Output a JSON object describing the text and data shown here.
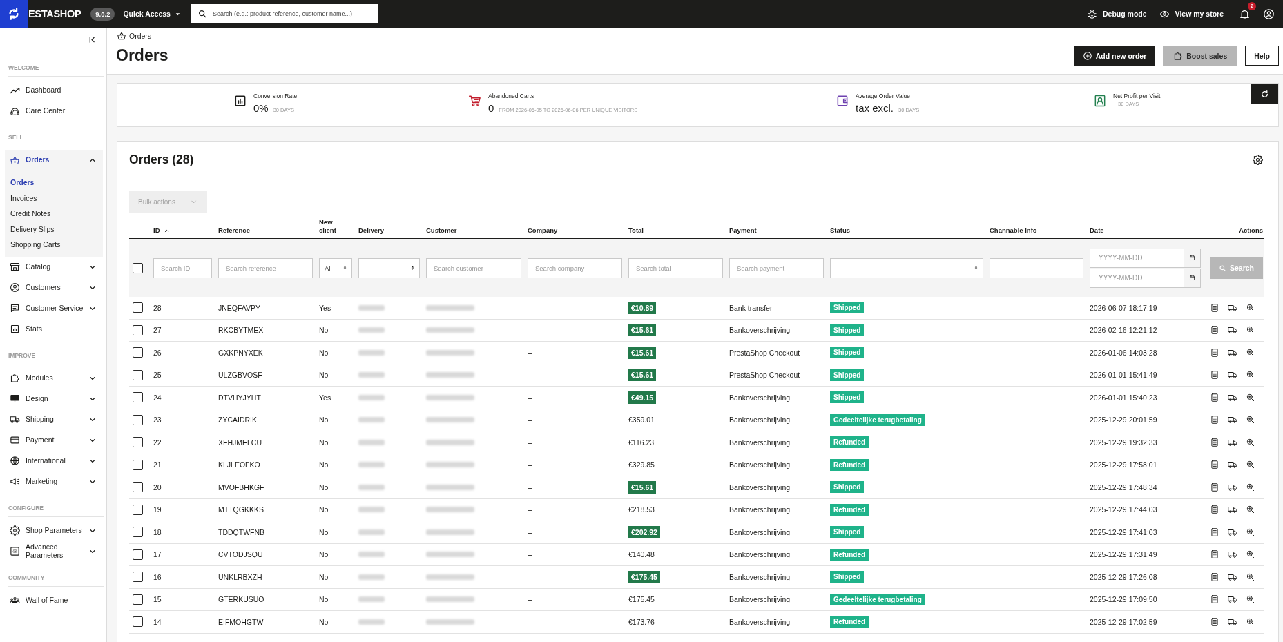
{
  "topbar": {
    "logo_text": "ESTASHOP",
    "version": "9.0.2",
    "quick_access": "Quick Access",
    "search": {
      "placeholder": "Search (e.g.: product reference, customer name...)"
    },
    "debug_mode": "Debug mode",
    "view_store": "View my store",
    "notification_count": "2"
  },
  "sidebar": {
    "sections": [
      {
        "title": "WELCOME",
        "items": [
          {
            "label": "Dashboard",
            "kind": "link",
            "selected": false
          },
          {
            "label": "Care Center",
            "kind": "link",
            "selected": false
          }
        ]
      },
      {
        "title": "SELL",
        "items": [
          {
            "label": "Orders",
            "kind": "menu",
            "selected": true,
            "expanded": true,
            "children": [
              {
                "label": "Orders",
                "selected": true
              },
              {
                "label": "Invoices",
                "selected": false
              },
              {
                "label": "Credit Notes",
                "selected": false
              },
              {
                "label": "Delivery Slips",
                "selected": false
              },
              {
                "label": "Shopping Carts",
                "selected": false
              }
            ]
          },
          {
            "label": "Catalog",
            "kind": "menu",
            "selected": false,
            "expanded": false
          },
          {
            "label": "Customers",
            "kind": "menu",
            "selected": false,
            "expanded": false
          },
          {
            "label": "Customer Service",
            "kind": "menu",
            "selected": false,
            "expanded": false
          },
          {
            "label": "Stats",
            "kind": "link",
            "selected": false
          }
        ]
      },
      {
        "title": "IMPROVE",
        "items": [
          {
            "label": "Modules",
            "kind": "menu",
            "selected": false,
            "expanded": false
          },
          {
            "label": "Design",
            "kind": "menu",
            "selected": false,
            "expanded": false
          },
          {
            "label": "Shipping",
            "kind": "menu",
            "selected": false,
            "expanded": false
          },
          {
            "label": "Payment",
            "kind": "menu",
            "selected": false,
            "expanded": false
          },
          {
            "label": "International",
            "kind": "menu",
            "selected": false,
            "expanded": false
          },
          {
            "label": "Marketing",
            "kind": "menu",
            "selected": false,
            "expanded": false
          }
        ]
      },
      {
        "title": "CONFIGURE",
        "items": [
          {
            "label": "Shop Parameters",
            "kind": "menu",
            "selected": false,
            "expanded": false
          },
          {
            "label": "Advanced Parameters",
            "kind": "menu",
            "selected": false,
            "expanded": false
          }
        ]
      },
      {
        "title": "COMMUNITY",
        "items": [
          {
            "label": "Wall of Fame",
            "kind": "link",
            "selected": false
          }
        ]
      }
    ]
  },
  "header": {
    "breadcrumb": "Orders",
    "title": "Orders",
    "buttons": [
      {
        "label": "Add new order",
        "kind": "primary"
      },
      {
        "label": "Boost sales",
        "kind": "secondary"
      },
      {
        "label": "Help",
        "kind": "outline"
      }
    ]
  },
  "kpis": [
    {
      "title": "Conversion Rate",
      "value": "0%",
      "period": "30 DAYS",
      "color": "#1d1d1b"
    },
    {
      "title": "Abandoned Carts",
      "value": "0",
      "period": "FROM 2026-06-05 TO 2026-06-06 PER UNIQUE VISITORS",
      "color": "#c3202f"
    },
    {
      "title": "Average Order Value",
      "value": "tax excl.",
      "period": "30 DAYS",
      "color": "#6f42b0"
    },
    {
      "title": "Net Profit per Visit",
      "period": "30 DAYS",
      "color": "#23804f"
    }
  ],
  "orders": {
    "title": "Orders (28)",
    "bulk_actions": {
      "label": "Bulk actions",
      "disabled": true
    },
    "select_all": {
      "checked": false
    },
    "columns": [
      {
        "label": "ID",
        "sorted_ascending": true
      },
      {
        "label": "Reference"
      },
      {
        "label": "New client"
      },
      {
        "label": "Delivery"
      },
      {
        "label": "Customer"
      },
      {
        "label": "Company"
      },
      {
        "label": "Total"
      },
      {
        "label": "Payment"
      },
      {
        "label": "Status"
      },
      {
        "label": "Channable Info"
      },
      {
        "label": "Date"
      },
      {
        "label": "Actions"
      }
    ],
    "filters": [
      {
        "kind": "input",
        "placeholder": "Search ID"
      },
      {
        "kind": "input",
        "placeholder": "Search reference"
      },
      {
        "kind": "select",
        "value": "All"
      },
      {
        "kind": "select"
      },
      {
        "kind": "input",
        "placeholder": "Search customer"
      },
      {
        "kind": "input",
        "placeholder": "Search company"
      },
      {
        "kind": "input",
        "placeholder": "Search total"
      },
      {
        "kind": "input",
        "placeholder": "Search payment"
      },
      {
        "kind": "select"
      },
      {
        "kind": "input"
      },
      {
        "kind": "date",
        "from_placeholder": "YYYY-MM-DD",
        "to_placeholder": "YYYY-MM-DD"
      },
      {
        "kind": "button",
        "label": "Search",
        "disabled": true
      }
    ],
    "rows": [
      {
        "checked": false,
        "id": "28",
        "reference": "JNEQFAVPY",
        "new_client": "Yes",
        "company": "--",
        "total": "€10.89",
        "total_highlighted": true,
        "payment": "Bank transfer",
        "status": "Shipped",
        "date": "2026-06-07 18:17:19"
      },
      {
        "checked": false,
        "id": "27",
        "reference": "RKCBYTMEX",
        "new_client": "No",
        "company": "--",
        "total": "€15.61",
        "total_highlighted": true,
        "payment": "Bankoverschrijving",
        "status": "Shipped",
        "date": "2026-02-16 12:21:12"
      },
      {
        "checked": false,
        "id": "26",
        "reference": "GXKPNYXEK",
        "new_client": "No",
        "company": "--",
        "total": "€15.61",
        "total_highlighted": true,
        "payment": "PrestaShop Checkout",
        "status": "Shipped",
        "date": "2026-01-06 14:03:28"
      },
      {
        "checked": false,
        "id": "25",
        "reference": "ULZGBVOSF",
        "new_client": "No",
        "company": "--",
        "total": "€15.61",
        "total_highlighted": true,
        "payment": "PrestaShop Checkout",
        "status": "Shipped",
        "date": "2026-01-01 15:41:49"
      },
      {
        "checked": false,
        "id": "24",
        "reference": "DTVHYJYHT",
        "new_client": "Yes",
        "company": "--",
        "total": "€49.15",
        "total_highlighted": true,
        "payment": "Bankoverschrijving",
        "status": "Shipped",
        "date": "2026-01-01 15:40:23"
      },
      {
        "checked": false,
        "id": "23",
        "reference": "ZYCAIDRIK",
        "new_client": "No",
        "company": "--",
        "total": "€359.01",
        "total_highlighted": false,
        "payment": "Bankoverschrijving",
        "status": "Gedeeltelijke terugbetaling",
        "date": "2025-12-29 20:01:59"
      },
      {
        "checked": false,
        "id": "22",
        "reference": "XFHJMELCU",
        "new_client": "No",
        "company": "--",
        "total": "€116.23",
        "total_highlighted": false,
        "payment": "Bankoverschrijving",
        "status": "Refunded",
        "date": "2025-12-29 19:32:33"
      },
      {
        "checked": false,
        "id": "21",
        "reference": "KLJLEOFKO",
        "new_client": "No",
        "company": "--",
        "total": "€329.85",
        "total_highlighted": false,
        "payment": "Bankoverschrijving",
        "status": "Refunded",
        "date": "2025-12-29 17:58:01"
      },
      {
        "checked": false,
        "id": "20",
        "reference": "MVOFBHKGF",
        "new_client": "No",
        "company": "--",
        "total": "€15.61",
        "total_highlighted": true,
        "payment": "Bankoverschrijving",
        "status": "Shipped",
        "date": "2025-12-29 17:48:34"
      },
      {
        "checked": false,
        "id": "19",
        "reference": "MTTQGKKKS",
        "new_client": "No",
        "company": "--",
        "total": "€218.53",
        "total_highlighted": false,
        "payment": "Bankoverschrijving",
        "status": "Refunded",
        "date": "2025-12-29 17:44:03"
      },
      {
        "checked": false,
        "id": "18",
        "reference": "TDDQTWFNB",
        "new_client": "No",
        "company": "--",
        "total": "€202.92",
        "total_highlighted": true,
        "payment": "Bankoverschrijving",
        "status": "Shipped",
        "date": "2025-12-29 17:41:03"
      },
      {
        "checked": false,
        "id": "17",
        "reference": "CVTODJSQU",
        "new_client": "No",
        "company": "--",
        "total": "€140.48",
        "total_highlighted": false,
        "payment": "Bankoverschrijving",
        "status": "Refunded",
        "date": "2025-12-29 17:31:49"
      },
      {
        "checked": false,
        "id": "16",
        "reference": "UNKLRBXZH",
        "new_client": "No",
        "company": "--",
        "total": "€175.45",
        "total_highlighted": true,
        "payment": "Bankoverschrijving",
        "status": "Shipped",
        "date": "2025-12-29 17:26:08"
      },
      {
        "checked": false,
        "id": "15",
        "reference": "GTERKUSUO",
        "new_client": "No",
        "company": "--",
        "total": "€175.45",
        "total_highlighted": false,
        "payment": "Bankoverschrijving",
        "status": "Gedeeltelijke terugbetaling",
        "date": "2025-12-29 17:09:50"
      },
      {
        "checked": false,
        "id": "14",
        "reference": "EIFMOHGTW",
        "new_client": "No",
        "company": "--",
        "total": "€173.76",
        "total_highlighted": false,
        "payment": "Bankoverschrijving",
        "status": "Refunded",
        "date": "2025-12-29 17:02:59"
      }
    ]
  }
}
